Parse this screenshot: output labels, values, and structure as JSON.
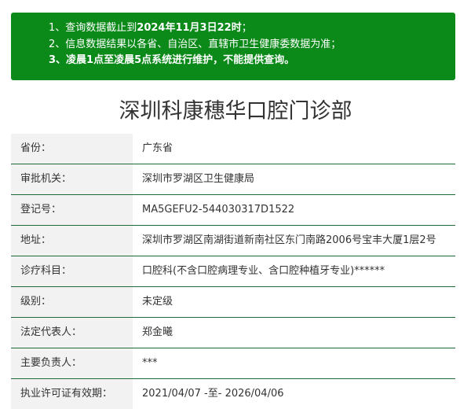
{
  "notice": {
    "line1_prefix": "1、查询数据截止到",
    "line1_bold": "2024年11月3日22时",
    "line1_suffix": "；",
    "line2": "2、信息数据结果以各省、自治区、直辖市卫生健康委数据为准；",
    "line3_prefix": "3、",
    "line3_bold": "凌晨1点至凌晨5点",
    "line3_suffix": "系统进行维护，不能提供查询。"
  },
  "title": "深圳科康穗华口腔门诊部",
  "rows": [
    {
      "label": "省份：",
      "value": "广东省"
    },
    {
      "label": "审批机关：",
      "value": "深圳市罗湖区卫生健康局"
    },
    {
      "label": "登记号：",
      "value": "MA5GEFU2-544030317D1522"
    },
    {
      "label": "地址：",
      "value": "深圳市罗湖区南湖街道新南社区东门南路2006号宝丰大厦1层2号"
    },
    {
      "label": "诊疗科目：",
      "value": "口腔科(不含口腔病理专业、含口腔种植牙专业)******"
    },
    {
      "label": "级别：",
      "value": "未定级"
    },
    {
      "label": "法定代表人：",
      "value": "郑金曦"
    },
    {
      "label": "主要负责人：",
      "value": "***"
    },
    {
      "label": "执业许可证有效期：",
      "value": "2021/04/07 -至- 2026/04/06"
    }
  ]
}
